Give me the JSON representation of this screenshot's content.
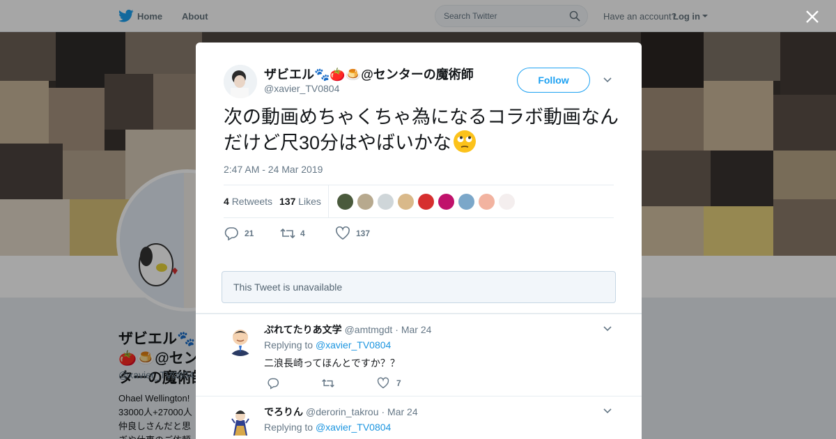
{
  "nav": {
    "home": "Home",
    "about": "About",
    "search_placeholder": "Search Twitter",
    "have_account": "Have an account?",
    "login": "Log in"
  },
  "profile": {
    "name": "ザビエル🐾🍅🍮@センターの魔術師",
    "handle": "@xavier_TV0804",
    "bio_lines": [
      "Ohael Wellington!",
      "33000人+27000人",
      "仲良しさんだと思",
      "ぎや仕事のご依頼"
    ]
  },
  "tweet": {
    "name": "ザビエル🐾🍅🍮@センターの魔術師",
    "handle": "@xavier_TV0804",
    "follow_label": "Follow",
    "text": "次の動画めちゃくちゃ為になるコラボ動画なんだけど尺30分はやばいかな",
    "timestamp": "2:47 AM - 24 Mar 2019",
    "retweets_count": "4",
    "retweets_label": "Retweets",
    "likes_count": "137",
    "likes_label": "Likes",
    "reply_count": "21",
    "retweet_count": "4",
    "like_count": "137",
    "liker_colors": [
      "#4a5a3c",
      "#b7a98e",
      "#cfd6d9",
      "#d9b98a",
      "#d62f2f",
      "#c0126b",
      "#7ba7c9",
      "#f2b3a0",
      "#f4eeee"
    ]
  },
  "unavailable_text": "This Tweet is unavailable",
  "replies": [
    {
      "name": "ぷれてたりあ文学",
      "handle": "@amtmgdt",
      "date": "· Mar 24",
      "replying_label": "Replying to",
      "replying_to": "@xavier_TV0804",
      "text": "二浪長崎ってほんとですか？？",
      "likes": "7"
    },
    {
      "name": "でろりん",
      "handle": "@derorin_takrou",
      "date": "· Mar 24",
      "replying_label": "Replying to",
      "replying_to": "@xavier_TV0804"
    }
  ],
  "colors": {
    "brand": "#1da1f2",
    "link": "#1b95e0",
    "muted": "#657786"
  }
}
